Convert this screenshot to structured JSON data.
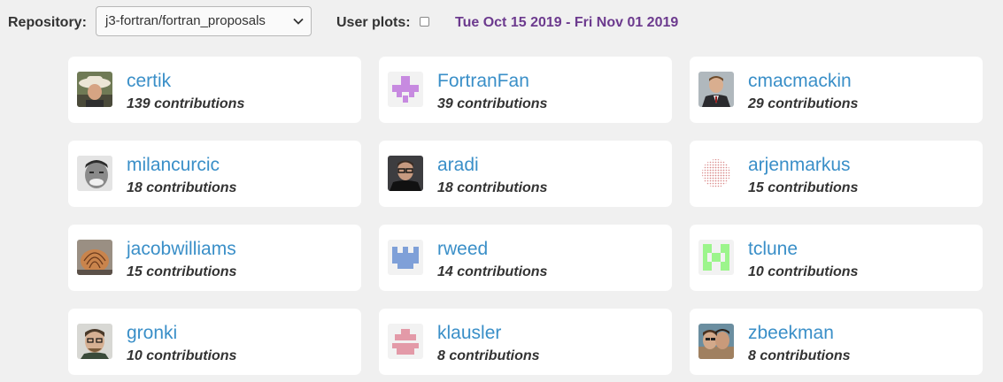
{
  "toolbar": {
    "repository_label": "Repository:",
    "repository_value": "j3-fortran/fortran_proposals",
    "user_plots_label": "User plots:",
    "user_plots_checked": false,
    "date_range": "Tue Oct 15 2019 - Fri Nov 01 2019"
  },
  "contributors": [
    {
      "name": "certik",
      "contributions": "139 contributions",
      "avatar": "photo-cowboy-hat"
    },
    {
      "name": "FortranFan",
      "contributions": "39 contributions",
      "avatar": "identicon-purple"
    },
    {
      "name": "cmacmackin",
      "contributions": "29 contributions",
      "avatar": "photo-suit"
    },
    {
      "name": "milancurcic",
      "contributions": "18 contributions",
      "avatar": "photo-bw-portrait"
    },
    {
      "name": "aradi",
      "contributions": "18 contributions",
      "avatar": "photo-glasses"
    },
    {
      "name": "arjenmarkus",
      "contributions": "15 contributions",
      "avatar": "dotted-pattern"
    },
    {
      "name": "jacobwilliams",
      "contributions": "15 contributions",
      "avatar": "photo-shell"
    },
    {
      "name": "rweed",
      "contributions": "14 contributions",
      "avatar": "identicon-blue"
    },
    {
      "name": "tclune",
      "contributions": "10 contributions",
      "avatar": "identicon-green"
    },
    {
      "name": "gronki",
      "contributions": "10 contributions",
      "avatar": "photo-man"
    },
    {
      "name": "klausler",
      "contributions": "8 contributions",
      "avatar": "identicon-pink"
    },
    {
      "name": "zbeekman",
      "contributions": "8 contributions",
      "avatar": "photo-couple"
    }
  ],
  "colors": {
    "background": "#f0f0f0",
    "card": "#ffffff",
    "username": "#3a8fc8",
    "date_range": "#6c3a8e"
  }
}
